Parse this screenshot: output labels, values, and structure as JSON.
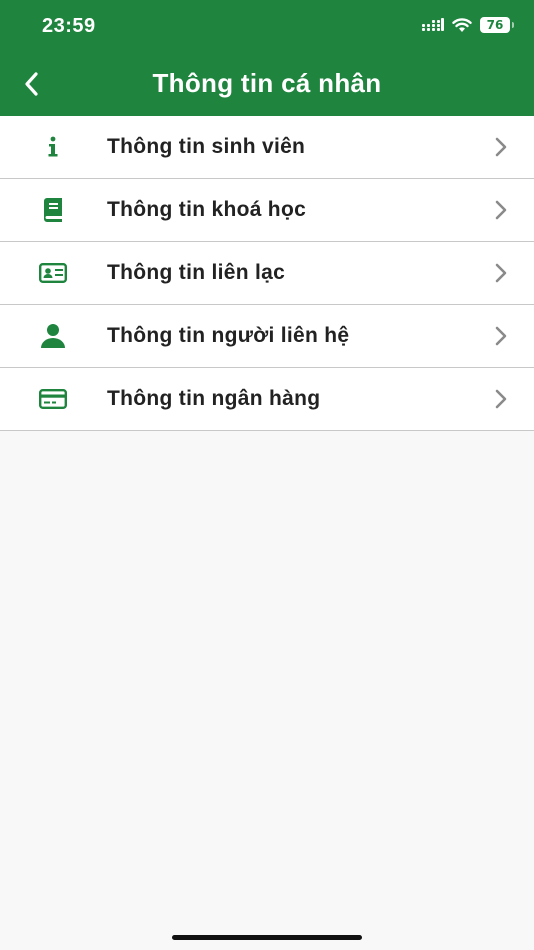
{
  "status_bar": {
    "time": "23:59",
    "battery": "76"
  },
  "header": {
    "title": "Thông tin cá nhân",
    "back_icon": "chevron-left-icon"
  },
  "menu": {
    "items": [
      {
        "label": "Thông tin sinh viên",
        "icon": "info-icon"
      },
      {
        "label": "Thông tin khoá học",
        "icon": "book-icon"
      },
      {
        "label": "Thông tin liên lạc",
        "icon": "contact-card-icon"
      },
      {
        "label": "Thông tin người liên hệ",
        "icon": "person-icon"
      },
      {
        "label": "Thông tin ngân hàng",
        "icon": "credit-card-icon"
      }
    ]
  },
  "colors": {
    "brand": "#1e843e",
    "icon": "#1e843e",
    "text": "#222222",
    "chevron": "#8a8a8a",
    "background": "#f8f8f8"
  }
}
